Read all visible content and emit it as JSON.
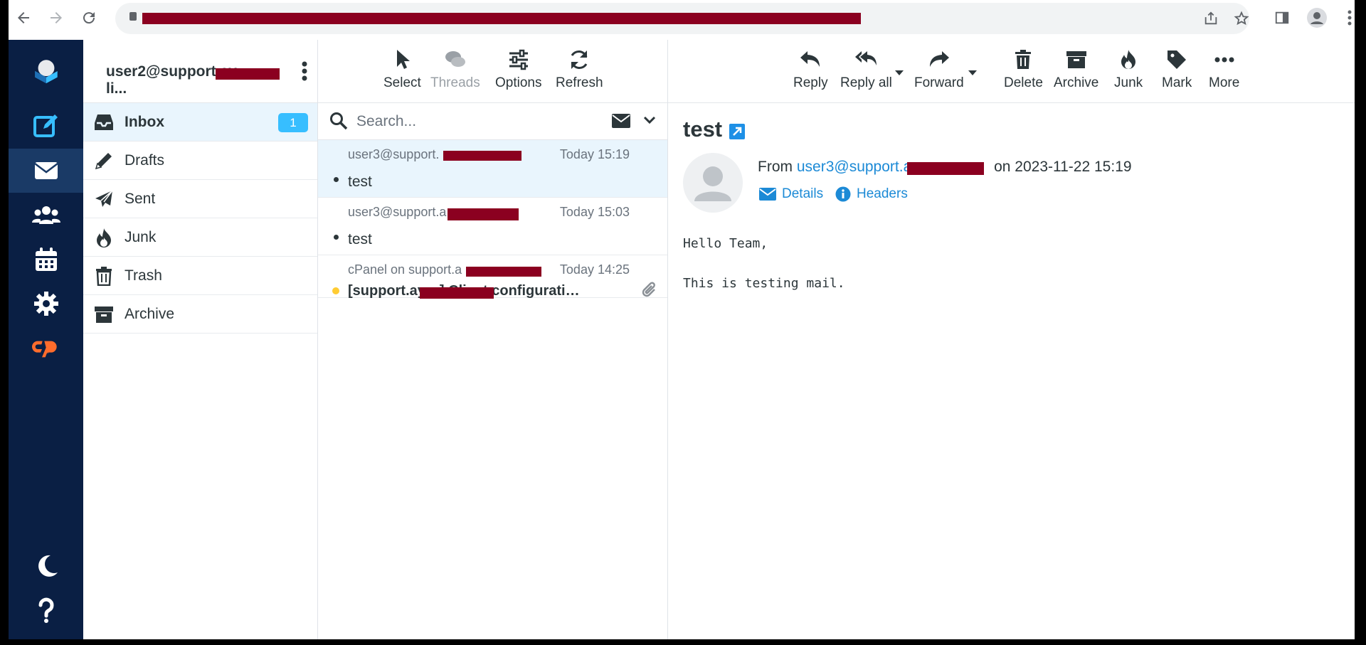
{
  "nav": {
    "items": [
      {
        "name": "logo",
        "icon": "roundcube-logo-icon"
      },
      {
        "name": "compose",
        "icon": "compose-icon"
      },
      {
        "name": "mail",
        "icon": "envelope-icon"
      },
      {
        "name": "contacts",
        "icon": "contacts-icon"
      },
      {
        "name": "calendar",
        "icon": "calendar-icon"
      },
      {
        "name": "settings",
        "icon": "gear-icon"
      },
      {
        "name": "cpanel",
        "icon": "cpanel-logo-icon"
      },
      {
        "name": "dark-mode",
        "icon": "moon-icon"
      },
      {
        "name": "help",
        "icon": "question-icon"
      }
    ],
    "accent": "#0a1f44"
  },
  "account": {
    "email": "user2@support.ay",
    "suffix": "li..."
  },
  "folders": [
    {
      "label": "Inbox",
      "badge": "1",
      "icon": "inbox-icon"
    },
    {
      "label": "Drafts",
      "icon": "pencil-icon"
    },
    {
      "label": "Sent",
      "icon": "paper-plane-icon"
    },
    {
      "label": "Junk",
      "icon": "fire-icon"
    },
    {
      "label": "Trash",
      "icon": "trash-icon"
    },
    {
      "label": "Archive",
      "icon": "archive-icon"
    }
  ],
  "list_toolbar": {
    "select": "Select",
    "threads": "Threads",
    "options": "Options",
    "refresh": "Refresh"
  },
  "search": {
    "placeholder": "Search..."
  },
  "messages": [
    {
      "from": "user3@support.",
      "date": "Today 15:19",
      "subject": "test"
    },
    {
      "from": "user3@support.a",
      "date": "Today 15:03",
      "subject": "test"
    },
    {
      "from": "cPanel on support.a",
      "date": "Today 14:25",
      "subject": "[support.ay",
      "subject_suffix": "] Client configurati…"
    }
  ],
  "reader_toolbar": {
    "reply": "Reply",
    "reply_all": "Reply all",
    "forward": "Forward",
    "delete": "Delete",
    "archive": "Archive",
    "junk": "Junk",
    "mark": "Mark",
    "more": "More"
  },
  "message": {
    "subject": "test",
    "from_label": "From",
    "from_email": "user3@support.a",
    "date_text": "on 2023-11-22 15:19",
    "details": "Details",
    "headers": "Headers",
    "body": "Hello Team,\n\nThis is testing mail."
  }
}
